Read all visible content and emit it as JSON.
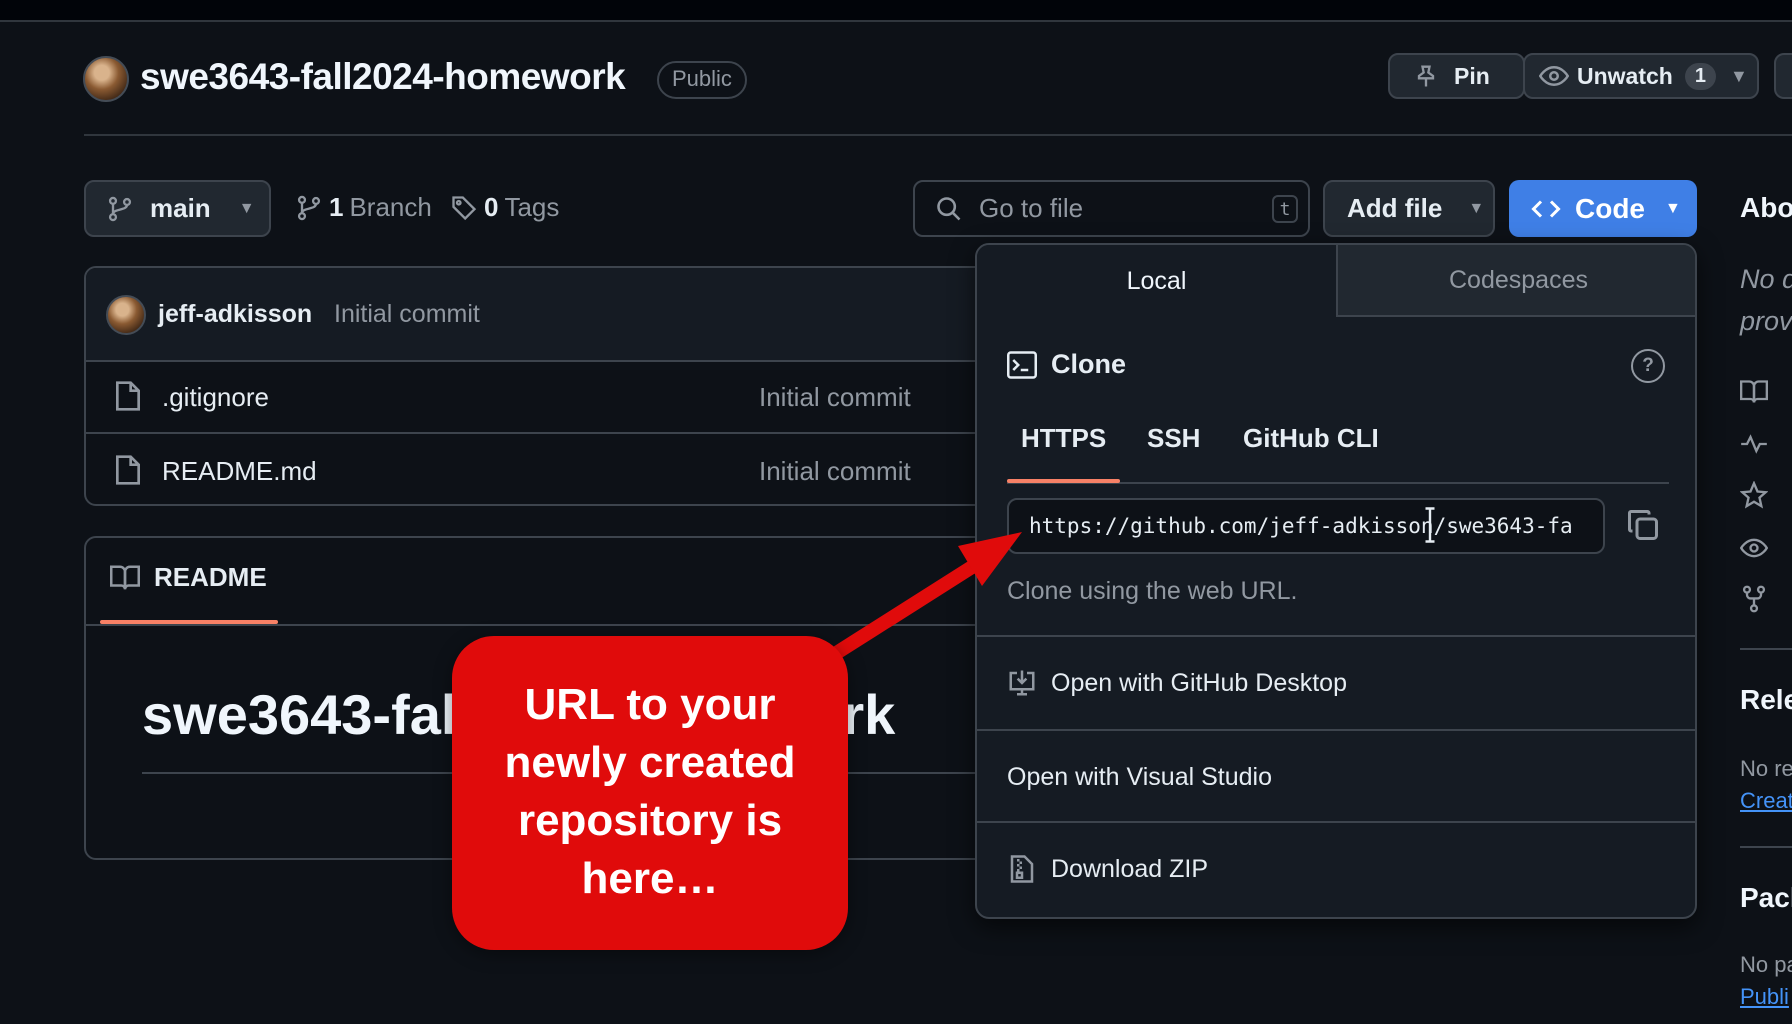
{
  "repo": {
    "name": "swe3643-fall2024-homework",
    "visibility": "Public",
    "pin_label": "Pin",
    "unwatch_label": "Unwatch",
    "watch_count": "1"
  },
  "branch_bar": {
    "branch": "main",
    "branch_count": "1",
    "branch_label": "Branch",
    "tag_count": "0",
    "tag_label": "Tags",
    "goto_placeholder": "Go to file",
    "goto_shortcut": "t",
    "add_file_label": "Add file",
    "code_label": "Code"
  },
  "commit": {
    "author": "jeff-adkisson",
    "message": "Initial commit"
  },
  "files": [
    {
      "name": ".gitignore",
      "commit": "Initial commit"
    },
    {
      "name": "README.md",
      "commit": "Initial commit"
    }
  ],
  "readme": {
    "tab_label": "README",
    "heading": "swe3643-fall2024-homework"
  },
  "clone_menu": {
    "tabs": [
      "Local",
      "Codespaces"
    ],
    "clone_title": "Clone",
    "help_glyph": "?",
    "protocols": [
      "HTTPS",
      "SSH",
      "GitHub CLI"
    ],
    "url": "https://github.com/jeff-adkisson/swe3643-fa",
    "hint": "Clone using the web URL.",
    "actions": [
      "Open with GitHub Desktop",
      "Open with Visual Studio",
      "Download ZIP"
    ]
  },
  "sidebar": {
    "about": "Abo",
    "desc_line1": "No d",
    "desc_line2": "prov",
    "releases": "Rele",
    "releases_text": "No re",
    "releases_link": "Creat",
    "packages": "Pack",
    "packages_text": "No pa",
    "packages_link": "Publi"
  },
  "annotation": {
    "text": "URL to your newly created repository is here…"
  },
  "colors": {
    "background": "#0d1117",
    "code_button": "#3f7fe6",
    "tab_underline": "#f78166",
    "annotation": "#e00b0b"
  }
}
